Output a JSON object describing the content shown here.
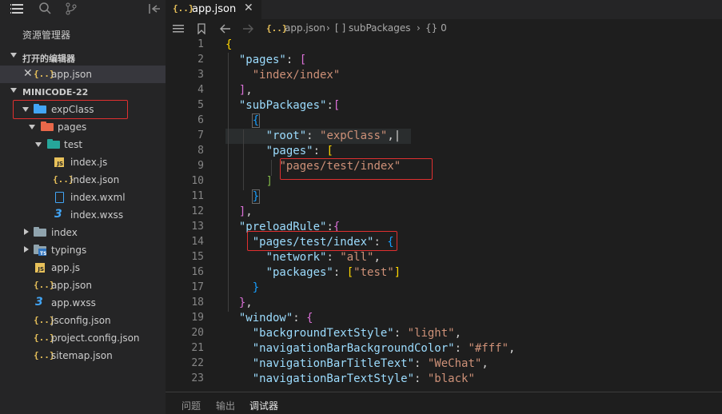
{
  "sidebar": {
    "explorer_title": "资源管理器",
    "open_editors_header": "打开的编辑器",
    "open_editor_file": "app.json",
    "project_header": "MINICODE-22",
    "tree": {
      "expClass": "expClass",
      "pages": "pages",
      "test": "test",
      "index_js": "index.js",
      "index_json": "index.json",
      "index_wxml": "index.wxml",
      "index_wxss": "index.wxss",
      "index": "index",
      "typings": "typings",
      "app_js": "app.js",
      "app_json": "app.json",
      "app_wxss": "app.wxss",
      "jsconfig": "jsconfig.json",
      "project_config": "project.config.json",
      "sitemap": "sitemap.json"
    },
    "icons": {
      "json_glyph": "{..}",
      "js_glyph": "JS",
      "ts_glyph": "TS",
      "css_glyph": "3"
    }
  },
  "editor": {
    "tab_label": "app.json",
    "tab_close": "✕",
    "breadcrumb": {
      "file": "app.json",
      "array": "[ ] subPackages",
      "object": "{} 0",
      "sep": "›"
    },
    "line_numbers": [
      "1",
      "2",
      "3",
      "4",
      "5",
      "6",
      "7",
      "8",
      "9",
      "10",
      "11",
      "12",
      "13",
      "14",
      "15",
      "16",
      "17",
      "18",
      "19",
      "20",
      "21",
      "22",
      "23"
    ]
  },
  "code": {
    "l1_brace": "{",
    "l2_key": "\"pages\"",
    "l2_rest": ": ",
    "l2_br": "[",
    "l3_val": "\"index/index\"",
    "l4_br": "]",
    "l4_c": ",",
    "l5_key": "\"subPackages\"",
    "l5_rest": ":",
    "l5_br": "[",
    "l6_br": "{",
    "l7_key": "\"root\"",
    "l7_colon": ": ",
    "l7_val": "\"expClass\"",
    "l7_c": ",",
    "l8_key": "\"pages\"",
    "l8_colon": ": ",
    "l8_br": "[",
    "l9_val": "\"pages/test/index\"",
    "l10_br": "]",
    "l11_br": "}",
    "l12_br": "]",
    "l12_c": ",",
    "l13_key": "\"preloadRule\"",
    "l13_colon": ":",
    "l13_br": "{",
    "l14_key": "\"pages/test/index\"",
    "l14_colon": ": ",
    "l14_br": "{",
    "l15_key": "\"network\"",
    "l15_colon": ": ",
    "l15_val": "\"all\"",
    "l15_c": ",",
    "l16_key": "\"packages\"",
    "l16_colon": ": ",
    "l16_br1": "[",
    "l16_val": "\"test\"",
    "l16_br2": "]",
    "l17_br": "}",
    "l18_br": "}",
    "l18_c": ",",
    "l19_key": "\"window\"",
    "l19_colon": ": ",
    "l19_br": "{",
    "l20_key": "\"backgroundTextStyle\"",
    "l20_colon": ": ",
    "l20_val": "\"light\"",
    "l20_c": ",",
    "l21_key": "\"navigationBarBackgroundColor\"",
    "l21_colon": ": ",
    "l21_val": "\"#fff\"",
    "l21_c": ",",
    "l22_key": "\"navigationBarTitleText\"",
    "l22_colon": ": ",
    "l22_val": "\"WeChat\"",
    "l22_c": ",",
    "l23_key": "\"navigationBarTextStyle\"",
    "l23_colon": ": ",
    "l23_val": "\"black\""
  },
  "panel": {
    "problems": "问题",
    "output": "输出",
    "debugger": "调试器"
  },
  "colors": {
    "highlight_box": "#e03030",
    "sidebar_bg": "#252526",
    "editor_bg": "#1e1e1e",
    "key": "#9cdcfe",
    "string": "#ce9178"
  }
}
